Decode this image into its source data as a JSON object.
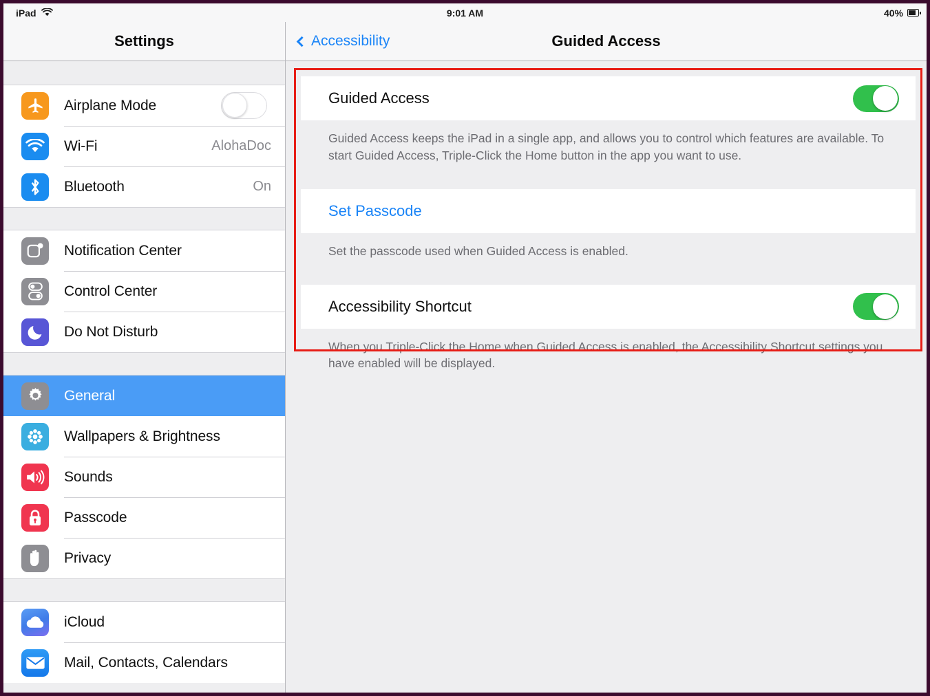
{
  "status_bar": {
    "device_label": "iPad",
    "wifi_icon": "wifi-icon",
    "time": "9:01 AM",
    "battery_percent": "40%",
    "battery_icon": "battery-icon"
  },
  "sidebar": {
    "title": "Settings",
    "groups": [
      {
        "items": [
          {
            "label": "Airplane Mode",
            "icon": "airplane-icon",
            "icon_class": "ic-airplane",
            "control": "switch",
            "switch_on": false
          },
          {
            "label": "Wi-Fi",
            "icon": "wifi-icon",
            "icon_class": "ic-wifi",
            "control": "value",
            "value": "AlohaDoc"
          },
          {
            "label": "Bluetooth",
            "icon": "bluetooth-icon",
            "icon_class": "ic-bt",
            "control": "value",
            "value": "On"
          }
        ]
      },
      {
        "items": [
          {
            "label": "Notification Center",
            "icon": "notification-center-icon",
            "icon_class": "ic-notif",
            "control": "none"
          },
          {
            "label": "Control Center",
            "icon": "control-center-icon",
            "icon_class": "ic-control",
            "control": "none"
          },
          {
            "label": "Do Not Disturb",
            "icon": "moon-icon",
            "icon_class": "ic-dnd",
            "control": "none"
          }
        ]
      },
      {
        "items": [
          {
            "label": "General",
            "icon": "gear-icon",
            "icon_class": "ic-general",
            "control": "none",
            "selected": true
          },
          {
            "label": "Wallpapers & Brightness",
            "icon": "wallpaper-icon",
            "icon_class": "ic-wall",
            "control": "none"
          },
          {
            "label": "Sounds",
            "icon": "speaker-icon",
            "icon_class": "ic-sounds",
            "control": "none"
          },
          {
            "label": "Passcode",
            "icon": "lock-icon",
            "icon_class": "ic-passcode",
            "control": "none"
          },
          {
            "label": "Privacy",
            "icon": "hand-icon",
            "icon_class": "ic-privacy",
            "control": "none"
          }
        ]
      },
      {
        "items": [
          {
            "label": "iCloud",
            "icon": "cloud-icon",
            "icon_class": "ic-icloud",
            "control": "none"
          },
          {
            "label": "Mail, Contacts, Calendars",
            "icon": "mail-icon",
            "icon_class": "ic-mail",
            "control": "none"
          }
        ]
      }
    ]
  },
  "detail": {
    "back_label": "Accessibility",
    "back_icon": "chevron-left-icon",
    "title": "Guided Access",
    "sections": [
      {
        "row_label": "Guided Access",
        "row_type": "switch",
        "switch_on": true,
        "note": "Guided Access keeps the iPad in a single app, and allows you to control which features are available. To start Guided Access, Triple-Click the Home button in the app you want to use."
      },
      {
        "row_label": "Set Passcode",
        "row_type": "link",
        "note": "Set the passcode used when Guided Access is enabled."
      },
      {
        "row_label": "Accessibility Shortcut",
        "row_type": "switch",
        "switch_on": true,
        "note": "When you Triple-Click the Home when Guided Access is enabled, the Accessibility Shortcut settings you have enabled will be displayed."
      }
    ]
  },
  "annotation": {
    "shape": "rectangle-highlight",
    "color": "#e71d16"
  },
  "colors": {
    "accent_blue": "#1a84f7",
    "selection_blue": "#4a9cf6",
    "switch_green": "#31c04c",
    "annotation_red": "#e71d16",
    "frame_border": "#3b0b2e"
  }
}
